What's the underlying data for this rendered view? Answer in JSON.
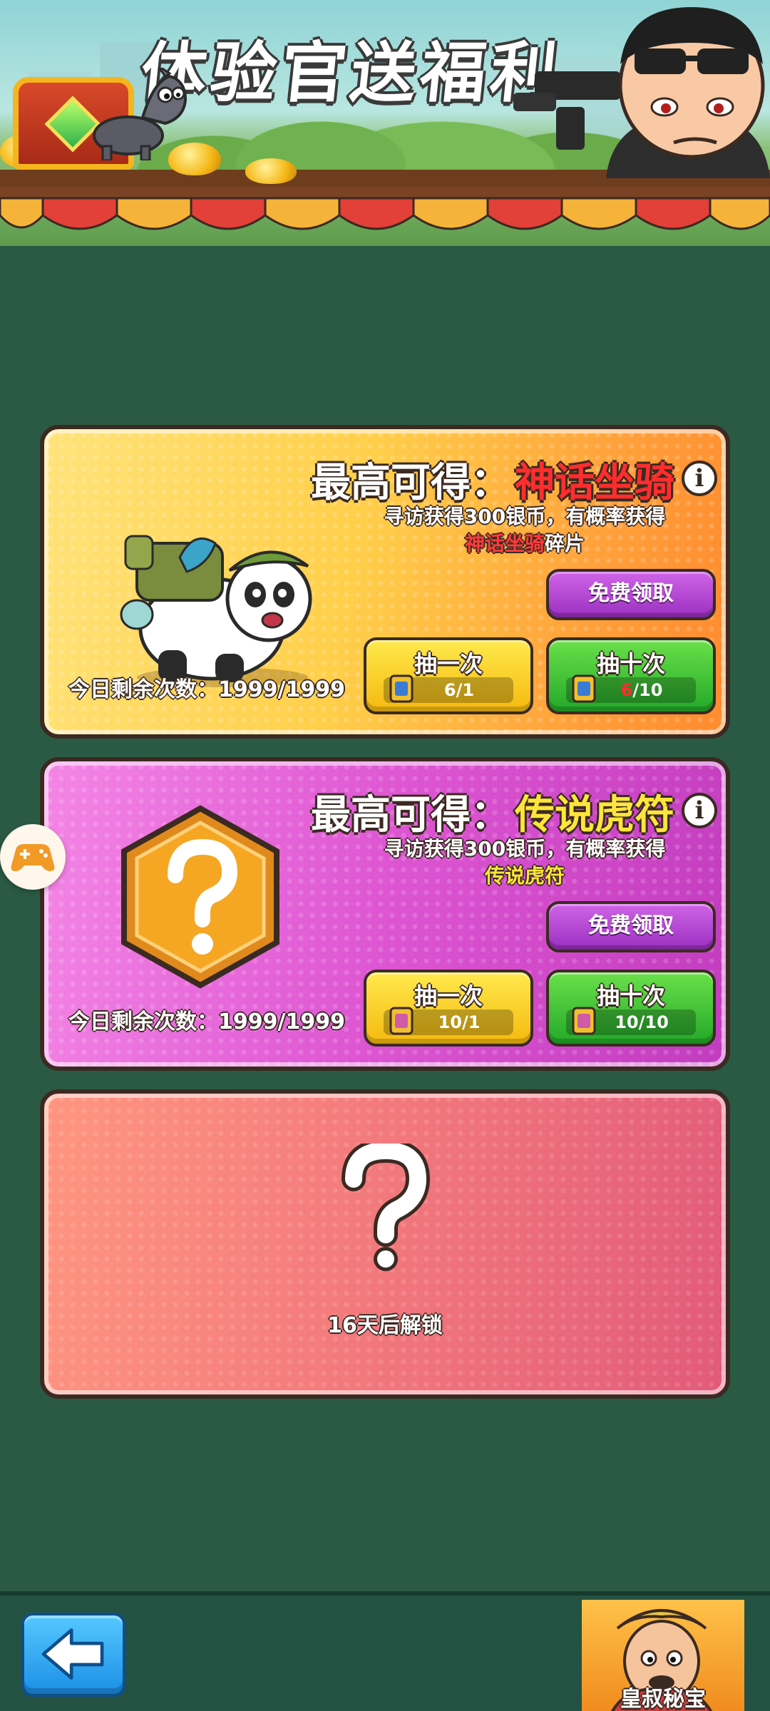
{
  "banner": {
    "title": "体验官送福利"
  },
  "cards": [
    {
      "headline_prefix": "最高可得：",
      "reward_name": "神话坐骑",
      "desc_prefix": "寻访获得300银币，有概率获得",
      "desc_highlight": "神话坐骑",
      "desc_suffix": "碎片",
      "free_label": "免费领取",
      "draw_one": {
        "label": "抽一次",
        "used": "6",
        "total": "/1"
      },
      "draw_ten": {
        "label": "抽十次",
        "used": "6",
        "total": "/10"
      },
      "remaining": "今日剩余次数：1999/1999"
    },
    {
      "headline_prefix": "最高可得：",
      "reward_name": "传说虎符",
      "desc_prefix": "寻访获得300银币，有概率获得",
      "desc_highlight": "传说虎符",
      "desc_suffix": "",
      "free_label": "免费领取",
      "draw_one": {
        "label": "抽一次",
        "used": "10",
        "total": "/1"
      },
      "draw_ten": {
        "label": "抽十次",
        "used": "10",
        "total": "/10"
      },
      "remaining": "今日剩余次数：1999/1999"
    },
    {
      "unlock_text": "16天后解锁"
    }
  ],
  "bottom": {
    "treasure_label": "皇叔秘宝"
  },
  "colors": {
    "background": "#2b5a44",
    "card1_accent": "#ffcf4a",
    "card2_accent": "#dd55d2",
    "card3_accent": "#f2787c",
    "free_button": "#9b2fc0",
    "draw_one_button": "#f5b90f",
    "draw_ten_button": "#23a829",
    "highlight_red": "#ff2d2d",
    "highlight_yellow": "#ffe53b"
  },
  "icons": [
    "treasure-chest-icon",
    "donkey-mascot-icon",
    "soldier-character-icon",
    "info-icon",
    "ticket-icon",
    "panda-mount-icon",
    "mystery-hexagon-icon",
    "question-mark-icon",
    "gamepad-icon",
    "back-arrow-icon",
    "uncle-character-icon"
  ]
}
